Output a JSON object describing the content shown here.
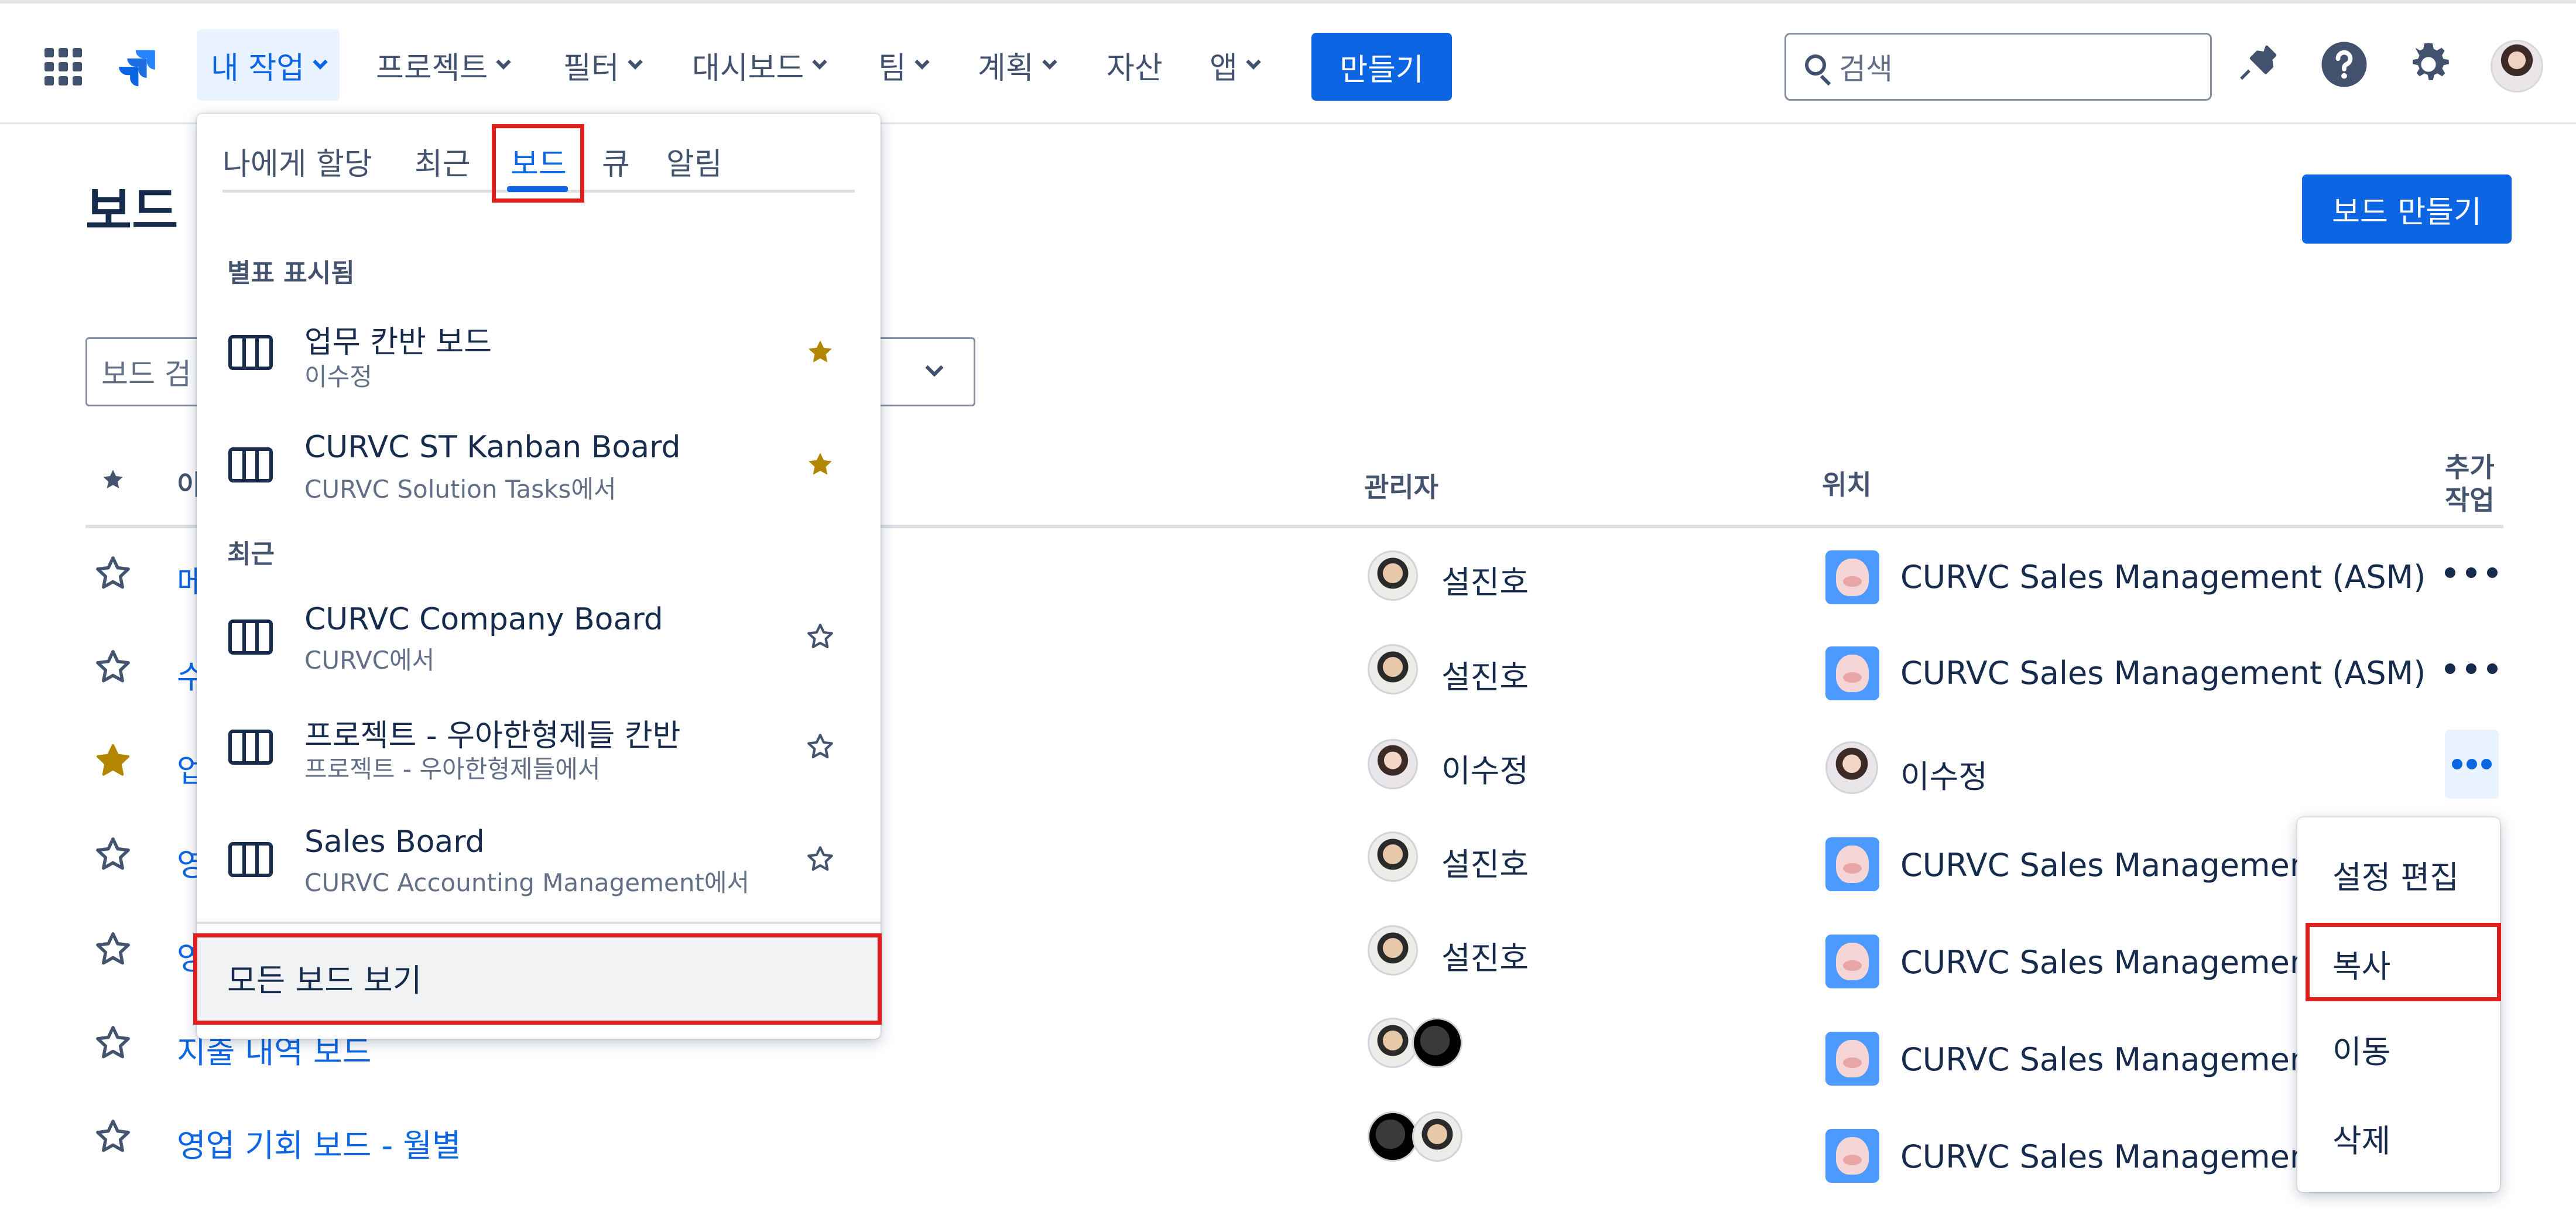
{
  "nav": {
    "items": [
      {
        "label": "내 작업",
        "chevron": true
      },
      {
        "label": "프로젝트",
        "chevron": true
      },
      {
        "label": "필터",
        "chevron": true
      },
      {
        "label": "대시보드",
        "chevron": true
      },
      {
        "label": "팀",
        "chevron": true
      },
      {
        "label": "계획",
        "chevron": true
      },
      {
        "label": "자산",
        "chevron": false
      },
      {
        "label": "앱",
        "chevron": true
      }
    ],
    "create_label": "만들기",
    "search_placeholder": "검색"
  },
  "page": {
    "title": "보드",
    "create_board_label": "보드 만들기",
    "search_placeholder": "보드 검"
  },
  "table": {
    "headers": {
      "name": "이",
      "admin": "관리자",
      "location": "위치",
      "more_line1": "추가",
      "more_line2": "작업"
    },
    "rows": [
      {
        "name": "메",
        "starred": false,
        "admin": "설진호",
        "admin_avatar": "male",
        "location": "CURVC Sales Management (ASM)",
        "location_icon": "project"
      },
      {
        "name": "수",
        "starred": false,
        "admin": "설진호",
        "admin_avatar": "male",
        "location": "CURVC Sales Management (ASM)",
        "location_icon": "project"
      },
      {
        "name": "업",
        "starred": true,
        "admin": "이수정",
        "admin_avatar": "female",
        "location": "이수정",
        "location_icon": "user"
      },
      {
        "name": "영",
        "starred": false,
        "admin": "설진호",
        "admin_avatar": "male",
        "location": "CURVC Sales Management (A",
        "location_icon": "project"
      },
      {
        "name": "영",
        "starred": false,
        "admin": "설진호",
        "admin_avatar": "male",
        "location": "CURVC Sales Management (A",
        "location_icon": "project"
      },
      {
        "name": "지출 내역 보드",
        "starred": false,
        "admin": "",
        "admin_avatar": "pair",
        "location": "CURVC Sales Management (A",
        "location_icon": "project"
      },
      {
        "name": "영업 기회 보드 - 월별",
        "starred": false,
        "admin": "",
        "admin_avatar": "pair",
        "location": "CURVC Sales Management (A",
        "location_icon": "project"
      }
    ]
  },
  "my_work_menu": {
    "tabs": [
      "나에게 할당",
      "최근",
      "보드",
      "큐",
      "알림"
    ],
    "active_tab": "보드",
    "starred_heading": "별표 표시됨",
    "recent_heading": "최근",
    "starred": [
      {
        "title": "업무 칸반 보드",
        "sub": "이수정",
        "starred": true
      },
      {
        "title": "CURVC ST Kanban Board",
        "sub": "CURVC Solution Tasks에서",
        "starred": true
      }
    ],
    "recent": [
      {
        "title": "CURVC Company Board",
        "sub": "CURVC에서",
        "starred": false
      },
      {
        "title": "프로젝트 - 우아한형제들 칸반",
        "sub": "프로젝트 - 우아한형제들에서",
        "starred": false
      },
      {
        "title": "Sales Board",
        "sub": "CURVC Accounting Management에서",
        "starred": false
      }
    ],
    "view_all_label": "모든 보드 보기"
  },
  "row_actions": {
    "items": [
      "설정 편집",
      "복사",
      "이동",
      "삭제"
    ]
  },
  "colors": {
    "accent": "#0c66e4",
    "star": "#b38600",
    "highlight": "#e01e1e"
  }
}
